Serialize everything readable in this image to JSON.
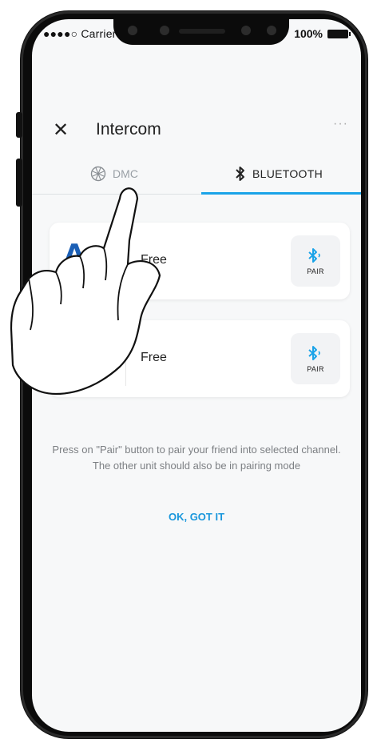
{
  "status_bar": {
    "carrier": "●●●●○ Carrier",
    "battery": "100%"
  },
  "header": {
    "title": "Intercom",
    "close_icon": "close-icon",
    "more_icon": "more-icon"
  },
  "tabs": [
    {
      "label": "DMC",
      "icon": "mesh-icon",
      "active": false
    },
    {
      "label": "BLUETOOTH",
      "icon": "bluetooth-icon",
      "active": true
    }
  ],
  "channels": [
    {
      "status": "Free",
      "pair_label": "PAIR"
    },
    {
      "status": "Free",
      "pair_label": "PAIR"
    }
  ],
  "hint": {
    "text": "Press on \"Pair\" button to pair your friend into selected channel. The other unit should also be in pairing mode"
  },
  "ok_button": {
    "label": "OK, GOT IT"
  },
  "colors": {
    "accent": "#1aa3e8",
    "logo": "#1b5fb5",
    "background": "#f7f8f9"
  }
}
